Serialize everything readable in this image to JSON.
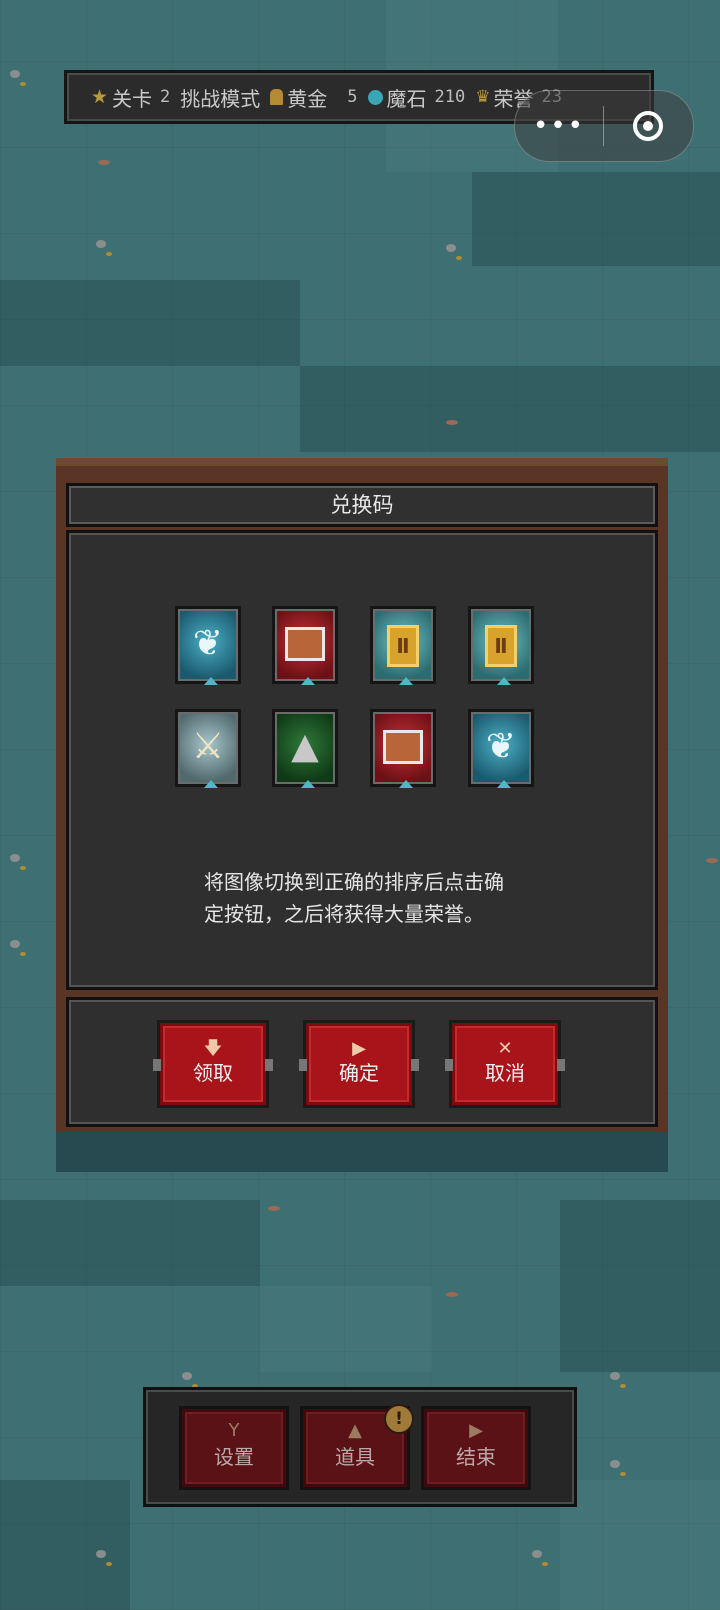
{
  "status_bar": {
    "level_label": "关卡",
    "level_value": "2",
    "mode_label": "挑战模式",
    "gold_label": "黄金",
    "gold_value": "5",
    "magic_stone_label": "魔石",
    "magic_stone_value": "210",
    "honor_label": "荣誉",
    "honor_value": "23"
  },
  "capsule": {
    "more_icon": "more-dots-icon",
    "close_icon": "target-circle-icon",
    "more_glyph": "•••"
  },
  "dialog": {
    "title": "兑换码",
    "tiles": [
      {
        "name": "wing-tile",
        "theme": "blue",
        "icon": "wing-icon"
      },
      {
        "name": "chest-tile",
        "theme": "red",
        "icon": "chest-icon"
      },
      {
        "name": "card-tile",
        "theme": "teal",
        "icon": "gold-card-icon"
      },
      {
        "name": "card-tile",
        "theme": "teal",
        "icon": "gold-card-icon"
      },
      {
        "name": "swords-tile",
        "theme": "grey",
        "icon": "crossed-swords-icon"
      },
      {
        "name": "tree-tile",
        "theme": "green",
        "icon": "tree-icon"
      },
      {
        "name": "chest-tile",
        "theme": "red",
        "icon": "chest-icon"
      },
      {
        "name": "wing-tile",
        "theme": "blue",
        "icon": "wing-icon"
      }
    ],
    "instruction_line1": "将图像切换到正确的排序后点击确",
    "instruction_line2": "定按钮，之后将获得大量荣誉。",
    "buttons": {
      "claim": "领取",
      "confirm": "确定",
      "cancel": "取消"
    }
  },
  "bottom_bar": {
    "settings": "设置",
    "items": "道具",
    "end": "结束",
    "items_badge": "!"
  },
  "colors": {
    "water": "#3e7073",
    "button_red": "#a8141a",
    "panel": "#2f2f2f",
    "frame_brown": "#5a3526"
  }
}
